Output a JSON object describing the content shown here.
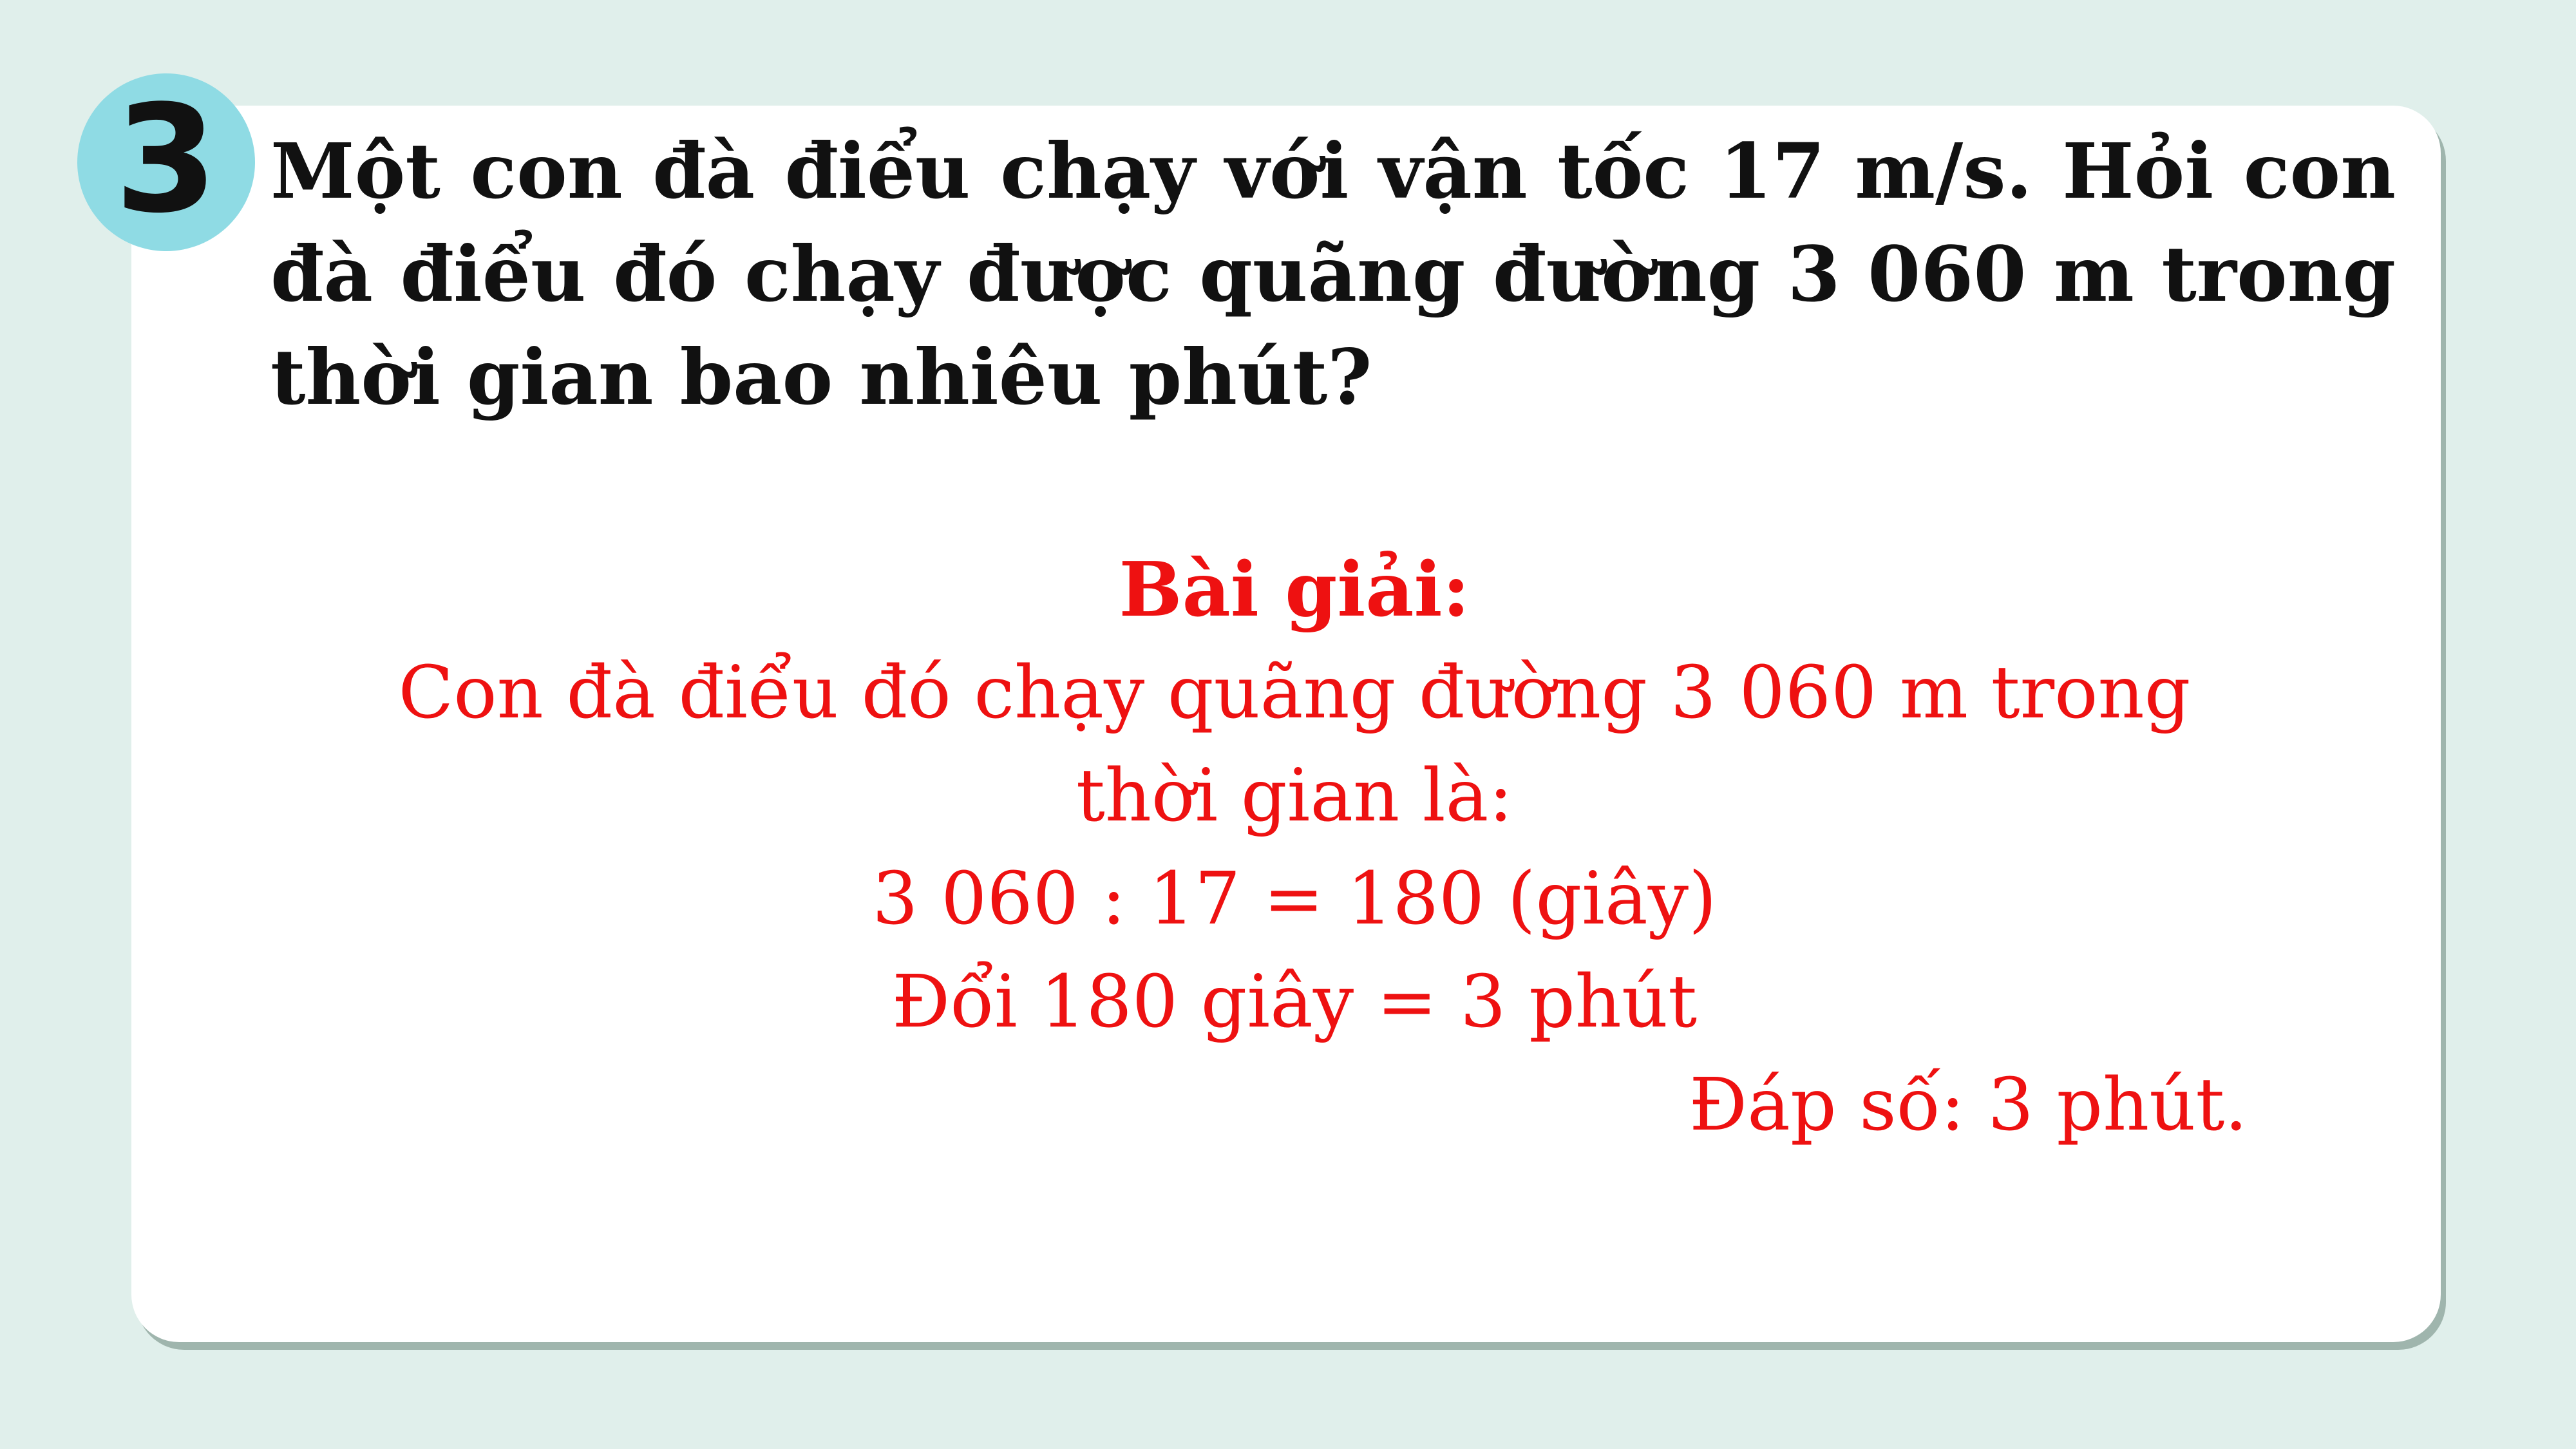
{
  "problem": {
    "number": "3",
    "text": "Một con đà điểu chạy với vận tốc 17 m/s. Hỏi con đà điểu đó chạy được quãng đường 3 060 m trong thời gian bao nhiêu phút?"
  },
  "solution": {
    "heading": "Bài giải:",
    "line1": "Con đà điểu đó chạy quãng đường 3 060 m trong",
    "line2": "thời gian là:",
    "calculation": "3 060 : 17 = 180 (giây)",
    "conversion": "Đổi 180 giây = 3 phút",
    "answer": "Đáp số: 3 phút."
  },
  "colors": {
    "background": "#e0efeb",
    "badge": "#8fdbe4",
    "solution_text": "#ee1111",
    "question_text": "#111111"
  }
}
